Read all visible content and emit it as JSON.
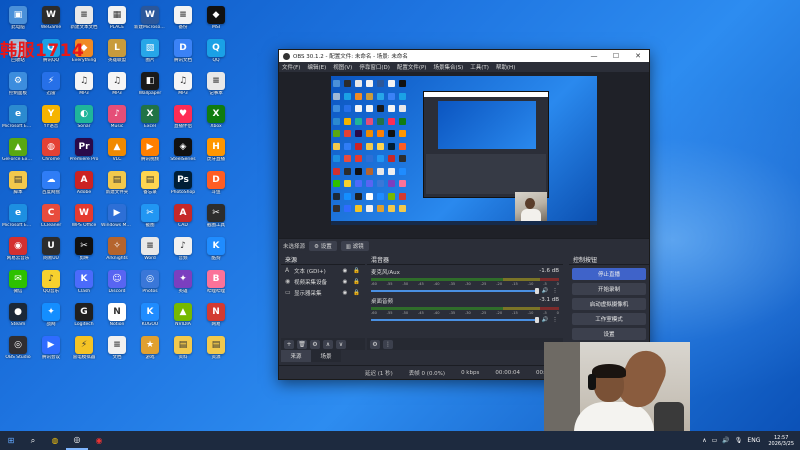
{
  "desktop": {
    "watermark": "韩服1714",
    "columns": [
      [
        {
          "label": "此电脑",
          "color": "#4a90d9",
          "glyph": "▣"
        },
        {
          "label": "回收站",
          "color": "#9fb8d6",
          "glyph": "♲"
        },
        {
          "label": "控制面板",
          "color": "#3c8dde",
          "glyph": "⚙"
        },
        {
          "label": "Microsoft Edge",
          "color": "#2b8ad0",
          "glyph": "e"
        },
        {
          "label": "GeForce Experience",
          "color": "#59a812",
          "glyph": "▲"
        },
        {
          "label": "脚本",
          "color": "#f2c94c",
          "glyph": "▤"
        },
        {
          "label": "Microsoft Edge",
          "color": "#1d8fe1",
          "glyph": "e"
        },
        {
          "label": "网易云音乐",
          "color": "#d43030",
          "glyph": "◉"
        },
        {
          "label": "微信",
          "color": "#2dc100",
          "glyph": "✉"
        },
        {
          "label": "Steam",
          "color": "#1b2838",
          "glyph": "●"
        },
        {
          "label": "OBS Studio",
          "color": "#302e31",
          "glyph": "◎"
        }
      ],
      [
        {
          "label": "WeGame",
          "color": "#2c2c2c",
          "glyph": "W"
        },
        {
          "label": "腾讯QQ",
          "color": "#1aa1e6",
          "glyph": "Q"
        },
        {
          "label": "迅雷",
          "color": "#2670e8",
          "glyph": "⚡"
        },
        {
          "label": "YY语音",
          "color": "#f5b400",
          "glyph": "Y"
        },
        {
          "label": "Chrome",
          "color": "#e44134",
          "glyph": "◍"
        },
        {
          "label": "百度网盘",
          "color": "#2f7df6",
          "glyph": "☁"
        },
        {
          "label": "CCleaner",
          "color": "#e84c3d",
          "glyph": "C"
        },
        {
          "label": "网易UU",
          "color": "#2c2c2c",
          "glyph": "U"
        },
        {
          "label": "QQ音乐",
          "color": "#f7d12e",
          "glyph": "♪"
        },
        {
          "label": "战网",
          "color": "#148eff",
          "glyph": "✦"
        },
        {
          "label": "腾讯会议",
          "color": "#2f6cff",
          "glyph": "▶"
        }
      ],
      [
        {
          "label": "新建文本文档",
          "color": "#e8e8e8",
          "glyph": "≡"
        },
        {
          "label": "Everything",
          "color": "#f08a24",
          "glyph": "◆"
        },
        {
          "label": "MP3",
          "color": "#f5f5f5",
          "glyph": "♫"
        },
        {
          "label": "Sonar",
          "color": "#1fb59a",
          "glyph": "◐"
        },
        {
          "label": "Premiere Pro",
          "color": "#2a0a4a",
          "glyph": "Pr"
        },
        {
          "label": "Adobe",
          "color": "#cc2222",
          "glyph": "A"
        },
        {
          "label": "WPS Office",
          "color": "#e53a2f",
          "glyph": "W"
        },
        {
          "label": "剪映",
          "color": "#111111",
          "glyph": "✂"
        },
        {
          "label": "Clash",
          "color": "#4b6bfb",
          "glyph": "K"
        },
        {
          "label": "Logitech",
          "color": "#202020",
          "glyph": "G"
        },
        {
          "label": "雷电模拟器",
          "color": "#f4c325",
          "glyph": "⚡"
        }
      ],
      [
        {
          "label": "PLACE",
          "color": "#f2f2f2",
          "glyph": "▦"
        },
        {
          "label": "英雄联盟",
          "color": "#c89b3c",
          "glyph": "L"
        },
        {
          "label": "MP3",
          "color": "#f5f5f5",
          "glyph": "♫"
        },
        {
          "label": "Music",
          "color": "#e54e78",
          "glyph": "♪"
        },
        {
          "label": "VLC",
          "color": "#f18a00",
          "glyph": "▲"
        },
        {
          "label": "新建文件夹",
          "color": "#f2c94c",
          "glyph": "▤"
        },
        {
          "label": "Windows Media",
          "color": "#2d6fd6",
          "glyph": "▶"
        },
        {
          "label": "Arknights",
          "color": "#b5642d",
          "glyph": "✧"
        },
        {
          "label": "Discord",
          "color": "#5865f2",
          "glyph": "☺"
        },
        {
          "label": "Notion",
          "color": "#ffffff",
          "glyph": "N"
        },
        {
          "label": "文档",
          "color": "#f0f0f0",
          "glyph": "≡"
        }
      ],
      [
        {
          "label": "新建Microsoft Word",
          "color": "#2b579a",
          "glyph": "W"
        },
        {
          "label": "图片",
          "color": "#27a6e8",
          "glyph": "▧"
        },
        {
          "label": "Wallpaper",
          "color": "#1a1a1a",
          "glyph": "◧"
        },
        {
          "label": "Excel",
          "color": "#217346",
          "glyph": "X"
        },
        {
          "label": "腾讯视频",
          "color": "#ff7f00",
          "glyph": "▶"
        },
        {
          "label": "备忘录",
          "color": "#ffd54f",
          "glyph": "▤"
        },
        {
          "label": "截图",
          "color": "#2196f3",
          "glyph": "✂"
        },
        {
          "label": "Word",
          "color": "#e8e8e8",
          "glyph": "≡"
        },
        {
          "label": "Photos",
          "color": "#3a77d8",
          "glyph": "◎"
        },
        {
          "label": "KUGOU",
          "color": "#1f8cff",
          "glyph": "K"
        },
        {
          "label": "游戏",
          "color": "#e0a030",
          "glyph": "★"
        }
      ],
      [
        {
          "label": "备份",
          "color": "#f3f3f3",
          "glyph": "≡"
        },
        {
          "label": "腾讯文档",
          "color": "#3b82f6",
          "glyph": "D"
        },
        {
          "label": "MP3",
          "color": "#f5f5f5",
          "glyph": "♫"
        },
        {
          "label": "直播伴侣",
          "color": "#fe2c55",
          "glyph": "♥"
        },
        {
          "label": "SteelSeries",
          "color": "#111",
          "glyph": "◈"
        },
        {
          "label": "PhotoShop",
          "color": "#001e36",
          "glyph": "Ps"
        },
        {
          "label": "CAD",
          "color": "#c62828",
          "glyph": "A"
        },
        {
          "label": "音频",
          "color": "#f0f0f0",
          "glyph": "♪"
        },
        {
          "label": "英雄",
          "color": "#7b3fbf",
          "glyph": "✦"
        },
        {
          "label": "NVIDIA",
          "color": "#76b900",
          "glyph": "▲"
        },
        {
          "label": "资料",
          "color": "#f2c94c",
          "glyph": "▤"
        }
      ],
      [
        {
          "label": "MSI",
          "color": "#111111",
          "glyph": "◆"
        },
        {
          "label": "QQ",
          "color": "#1aa1e6",
          "glyph": "Q"
        },
        {
          "label": "记事本",
          "color": "#e8e8e8",
          "glyph": "≡"
        },
        {
          "label": "Xbox",
          "color": "#107c10",
          "glyph": "X"
        },
        {
          "label": "虎牙直播",
          "color": "#ff9600",
          "glyph": "H"
        },
        {
          "label": "斗鱼",
          "color": "#ff5d23",
          "glyph": "D"
        },
        {
          "label": "截图工具",
          "color": "#2d2d2d",
          "glyph": "✂"
        },
        {
          "label": "酷狗",
          "color": "#1f8cff",
          "glyph": "K"
        },
        {
          "label": "哔哩哔哩",
          "color": "#fb7299",
          "glyph": "B"
        },
        {
          "label": "网易",
          "color": "#d33a31",
          "glyph": "N"
        },
        {
          "label": "资源",
          "color": "#f2c94c",
          "glyph": "▤"
        }
      ]
    ]
  },
  "obs": {
    "title": "OBS 30.1.2 - 配置文件: 未命名 - 场景: 未命名",
    "window_controls": [
      "—",
      "☐",
      "✕"
    ],
    "menu": [
      "文件(F)",
      "编辑(E)",
      "视图(V)",
      "停靠窗口(D)",
      "配置文件(P)",
      "场景集合(S)",
      "工具(T)",
      "帮助(H)"
    ],
    "source_bar": {
      "label": "未选择源",
      "buttons": [
        "⚙ 设置",
        "▥ 滤镜"
      ]
    },
    "sources": {
      "title": "来源",
      "items": [
        {
          "icon": "A",
          "name": "文本 (GDI+)",
          "tail": "◉ 🔒"
        },
        {
          "icon": "◉",
          "name": "视频采集设备",
          "tail": "◉ 🔒"
        },
        {
          "icon": "▭",
          "name": "显示器采集",
          "tail": "◉ 🔒"
        }
      ],
      "toolbar": [
        "+",
        "🗑",
        "⚙",
        "∧",
        "∨"
      ]
    },
    "mixer": {
      "title": "混音器",
      "channels": [
        {
          "name": "麦克风/Aux",
          "db": "-1.6 dB",
          "ticks": [
            "-60",
            "-55",
            "-50",
            "-45",
            "-40",
            "-35",
            "-30",
            "-25",
            "-20",
            "-15",
            "-10",
            "-5",
            "0"
          ],
          "volume": 0.98
        },
        {
          "name": "桌面音频",
          "db": "-3.1 dB",
          "ticks": [
            "-60",
            "-55",
            "-50",
            "-45",
            "-40",
            "-35",
            "-30",
            "-25",
            "-20",
            "-15",
            "-10",
            "-5",
            "0"
          ],
          "volume": 0.96
        }
      ],
      "toolbar": [
        "⚙",
        "⋮"
      ]
    },
    "controls": {
      "title": "控制按钮",
      "buttons": [
        "停止直播",
        "开始录制",
        "启动虚拟摄像机",
        "工作室模式",
        "设置"
      ]
    },
    "bottom_tabs": [
      "来源",
      "场景"
    ],
    "status": {
      "delay": "延迟 (1 秒)",
      "dropped": "丢帧 0 (0.0%)",
      "kbps": "0 kbps",
      "rec_time": "00:00:04",
      "time2": "00:00:00"
    }
  },
  "taskbar": {
    "items": [
      "⊞",
      "⌕",
      "◍",
      "◎",
      "◉"
    ],
    "tray": [
      "∧",
      "▭",
      "🔊",
      "🎙",
      "ENG"
    ],
    "time": "12:57",
    "date": "2026/3/25"
  },
  "colors": {
    "desktop_bg": "#1e74e0",
    "obs_bg": "#2b2e38",
    "obs_active": "#3f63c9",
    "watermark": "#e81818"
  }
}
